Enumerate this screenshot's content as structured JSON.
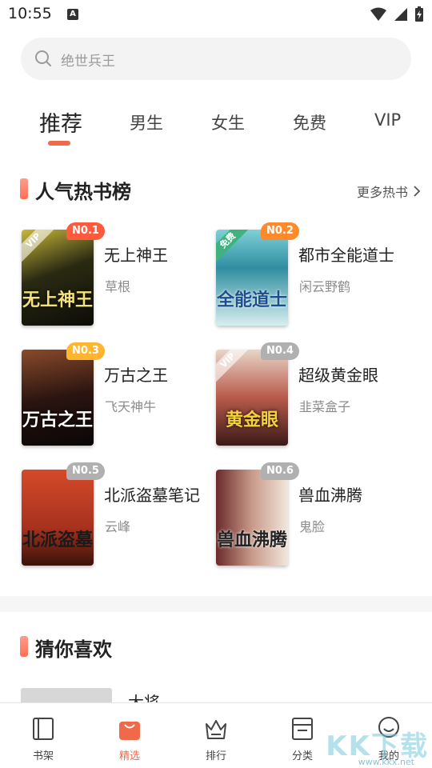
{
  "status_bar": {
    "time": "10:55",
    "notification_letter": "A"
  },
  "search": {
    "placeholder": "绝世兵王"
  },
  "tabs": [
    {
      "label": "推荐",
      "active": true
    },
    {
      "label": "男生",
      "active": false
    },
    {
      "label": "女生",
      "active": false
    },
    {
      "label": "免费",
      "active": false
    },
    {
      "label": "VIP",
      "active": false
    }
  ],
  "hot_section": {
    "title": "人气热书榜",
    "more_label": "更多热书",
    "books": [
      {
        "rank": "N0.1",
        "title": "无上神王",
        "author": "草根",
        "cover_tag": "VIP",
        "cover_text": "无上神王",
        "badge_color": "#ff5a3c"
      },
      {
        "rank": "N0.2",
        "title": "都市全能道士",
        "author": "闲云野鹤",
        "cover_tag": "免费",
        "cover_text": "全能道士",
        "badge_color": "#ff8a2a"
      },
      {
        "rank": "N0.3",
        "title": "万古之王",
        "author": "飞天神牛",
        "cover_tag": "",
        "cover_text": "万古之王",
        "badge_color": "#ffb62e"
      },
      {
        "rank": "N0.4",
        "title": "超级黄金眼",
        "author": "韭菜盒子",
        "cover_tag": "VIP",
        "cover_text": "黄金眼",
        "badge_color": "#b0b0b0"
      },
      {
        "rank": "N0.5",
        "title": "北派盗墓笔记",
        "author": "云峰",
        "cover_tag": "",
        "cover_text": "北派盗墓",
        "badge_color": "#b0b0b0"
      },
      {
        "rank": "N0.6",
        "title": "兽血沸腾",
        "author": "鬼脸",
        "cover_tag": "",
        "cover_text": "兽血沸腾",
        "badge_color": "#b0b0b0"
      }
    ]
  },
  "guess_section": {
    "title": "猜你喜欢",
    "first_item_title": "大将"
  },
  "bottom_nav": [
    {
      "label": "书架",
      "icon": "bookshelf-icon",
      "active": false
    },
    {
      "label": "精选",
      "icon": "shopping-bag-icon",
      "active": true
    },
    {
      "label": "排行",
      "icon": "crown-icon",
      "active": false
    },
    {
      "label": "分类",
      "icon": "category-icon",
      "active": false
    },
    {
      "label": "我的",
      "icon": "profile-icon",
      "active": false
    }
  ],
  "watermark": {
    "text": "KK下载",
    "url": "www.kkx.net"
  },
  "colors": {
    "accent": "#f06a4a",
    "muted": "#8c8c8c"
  }
}
